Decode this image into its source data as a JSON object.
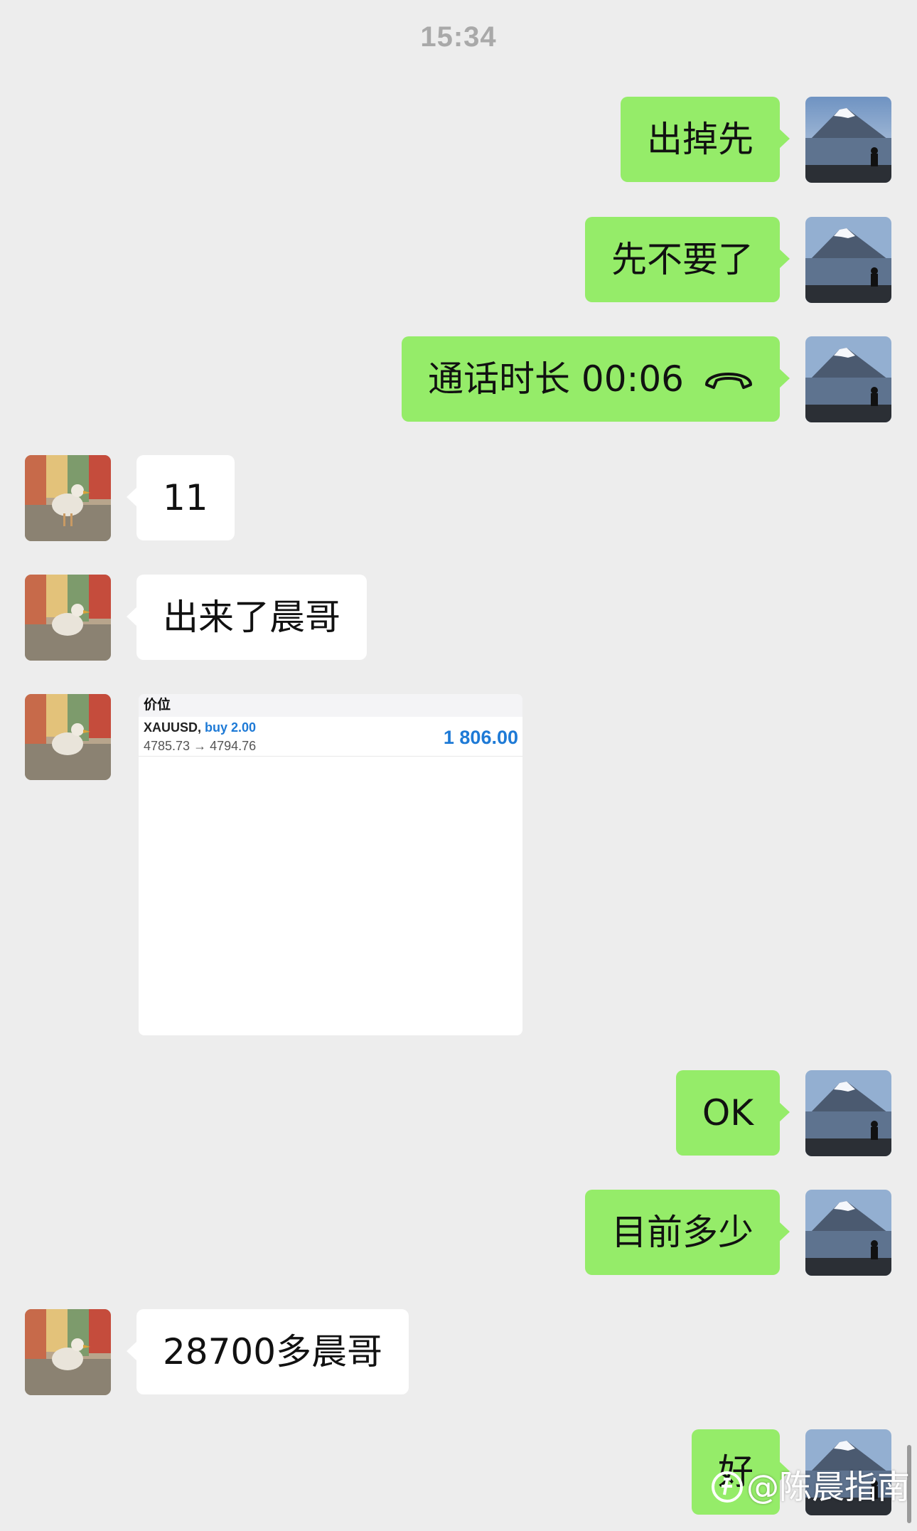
{
  "time_label": "15:34",
  "messages": [
    {
      "direction": "out",
      "text": "出掉先"
    },
    {
      "direction": "out",
      "text": "先不要了"
    },
    {
      "direction": "out",
      "text": "通话时长 00:06",
      "icon": "phone-hangup-icon"
    },
    {
      "direction": "in",
      "text": "11"
    },
    {
      "direction": "in",
      "text": "出来了晨哥"
    },
    {
      "direction": "in",
      "type": "image"
    },
    {
      "direction": "out",
      "text": "OK"
    },
    {
      "direction": "out",
      "text": "目前多少"
    },
    {
      "direction": "in",
      "text": "28700多晨哥"
    },
    {
      "direction": "out",
      "text": "好"
    }
  ],
  "trade_card": {
    "header": "价位",
    "symbol": "XAUUSD,",
    "side": "buy 2.00",
    "prices": "4785.73 → 4794.76",
    "profit": "1 806.00"
  },
  "watermark": "@陈晨指南",
  "colors": {
    "background": "#ededed",
    "outgoing_bubble": "#95ec69",
    "incoming_bubble": "#ffffff",
    "profit_blue": "#1e7ad6"
  }
}
